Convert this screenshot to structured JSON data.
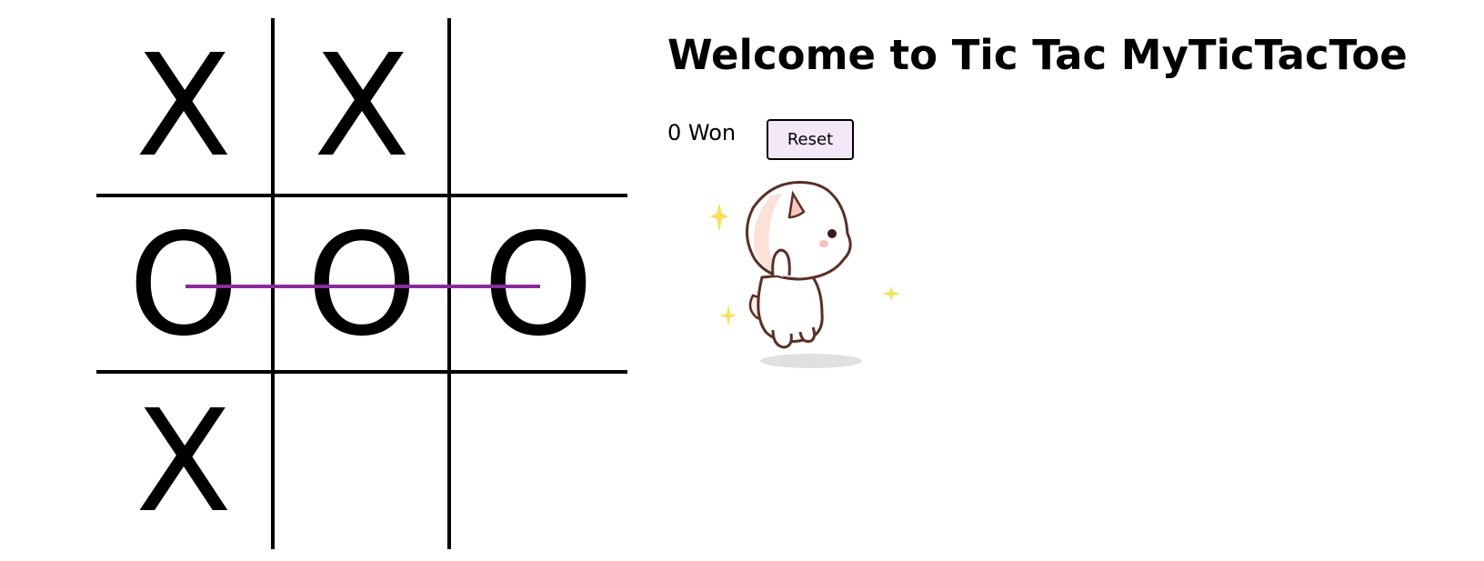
{
  "game": {
    "title": "Welcome to Tic Tac MyTicTacToe",
    "score_text": "0 Won",
    "reset_label": "Reset",
    "board": [
      [
        "X",
        "X",
        ""
      ],
      [
        "O",
        "O",
        "O"
      ],
      [
        "X",
        "",
        ""
      ]
    ],
    "winning_line": "row-2",
    "colors": {
      "win_line": "#8a2a9e",
      "reset_background": "#f3e8f8",
      "grid": "#000000"
    },
    "mascot": "cat-celebration-icon"
  }
}
